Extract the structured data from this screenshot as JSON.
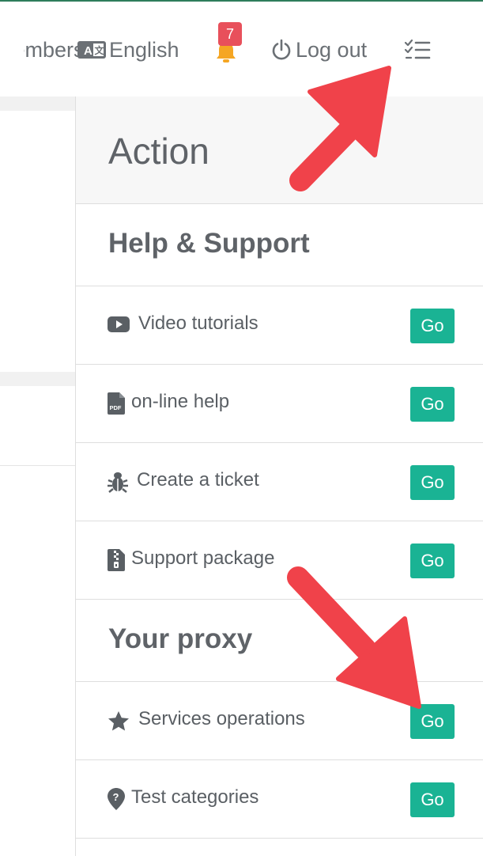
{
  "nav": {
    "members_label": "Members",
    "language_label": "English",
    "notification_count": "7",
    "logout_label": "Log out"
  },
  "panel": {
    "title": "Action",
    "sections": [
      {
        "title": "Help & Support",
        "rows": [
          {
            "icon": "youtube-icon",
            "label": "Video tutorials",
            "button": "Go"
          },
          {
            "icon": "pdf-file-icon",
            "label": "on-line help",
            "button": "Go"
          },
          {
            "icon": "bug-icon",
            "label": "Create a ticket",
            "button": "Go"
          },
          {
            "icon": "zip-file-icon",
            "label": "Support package",
            "button": "Go"
          }
        ]
      },
      {
        "title": "Your proxy",
        "rows": [
          {
            "icon": "star-icon",
            "label": "Services operations",
            "button": "Go"
          },
          {
            "icon": "map-marker-question-icon",
            "label": "Test categories",
            "button": "Go"
          }
        ]
      }
    ]
  },
  "colors": {
    "accent_green": "#1ab394",
    "badge_red": "#e8505b",
    "bell_orange": "#f5a623",
    "annotation_red": "#f0424a"
  }
}
